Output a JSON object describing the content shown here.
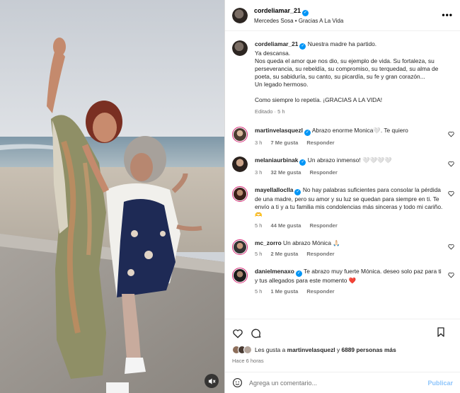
{
  "header": {
    "username": "cordeliamar_21",
    "audio": "Mercedes Sosa • Gracias A La Vida",
    "more_icon": "more-horizontal-icon"
  },
  "caption": {
    "username": "cordeliamar_21",
    "first_line": "Nuestra madre ha partido.",
    "line2": "Ya descansa.",
    "line3": "Nos queda el amor que nos dio, su ejemplo de vida. Su fortaleza, su perseverancia, su rebeldía, su compromiso, su terquedad, su alma de poeta, su sabiduría, su canto, su picardía, su fe y gran corazón...",
    "line4": "Un legado hermoso.",
    "line5": "Como siempre lo repetía. ¡GRACIAS A LA VIDA!",
    "meta": "Editado · 5 h"
  },
  "comments": [
    {
      "username": "martinvelasquezl",
      "text": "Abrazo enorme Monica🤍. Te quiero",
      "time": "3 h",
      "likes": "7 Me gusta",
      "reply": "Responder"
    },
    {
      "username": "melaniaurbinak",
      "text": "Un abrazo inmenso! 🤍🤍🤍🤍",
      "time": "3 h",
      "likes": "32 Me gusta",
      "reply": "Responder"
    },
    {
      "username": "mayellalloclla",
      "text": "No hay palabras suficientes para consolar la pérdida de una madre, pero su amor y su luz se quedan para siempre en ti. Te envío a ti y a tu familia mis condolencias más sinceras y todo mi cariño. 🫶",
      "time": "5 h",
      "likes": "44 Me gusta",
      "reply": "Responder"
    },
    {
      "username": "mc_zorro",
      "text": "Un abrazo Mónica 🙏🏻",
      "time": "5 h",
      "likes": "2 Me gusta",
      "reply": "Responder"
    },
    {
      "username": "danielmenaxo",
      "text": "Te abrazo muy fuerte Mónica. deseo solo paz para ti y tus allegados para este momento ❤️",
      "time": "5 h",
      "likes": "1 Me gusta",
      "reply": "Responder"
    }
  ],
  "actions": {
    "likes_prefix": "Les gusta a",
    "likes_user": "martinvelasquezl",
    "likes_and": "y",
    "likes_count": "6889 personas más",
    "time_ago": "Hace 6 horas"
  },
  "add_comment": {
    "placeholder": "Agrega un comentario...",
    "publish": "Publicar"
  },
  "colors": {
    "verified": "#0095f6",
    "story_ring": "#d62976",
    "publish_disabled": "#8ec5fb",
    "heart_red": "#ed4956"
  }
}
